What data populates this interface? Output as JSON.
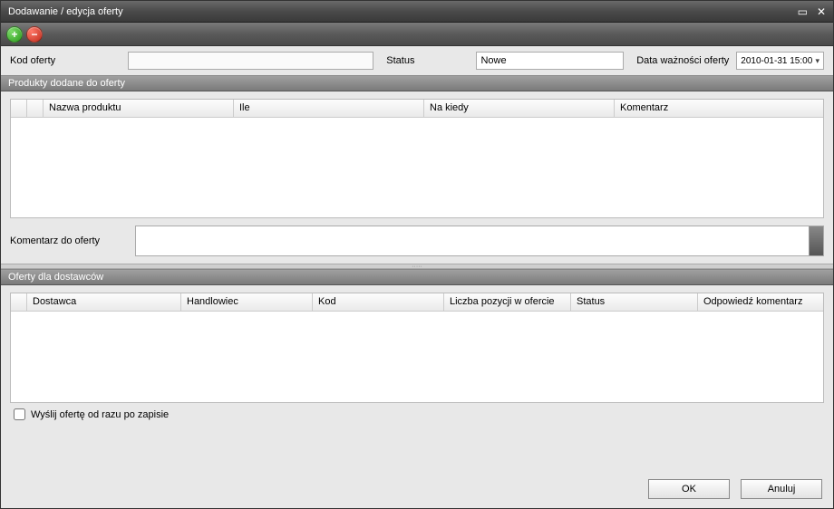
{
  "window": {
    "title": "Dodawanie / edycja oferty"
  },
  "toolbar": {
    "add_title": "Dodaj",
    "remove_title": "Usuń"
  },
  "form": {
    "kod_label": "Kod oferty",
    "kod_value": "",
    "status_label": "Status",
    "status_value": "Nowe",
    "validity_label": "Data ważności oferty",
    "validity_value": "2010-01-31 15:00"
  },
  "products_section": {
    "title": "Produkty dodane do oferty",
    "columns": {
      "name": "Nazwa produktu",
      "qty": "Ile",
      "when": "Na kiedy",
      "comment": "Komentarz"
    },
    "comment_label": "Komentarz do oferty",
    "comment_value": ""
  },
  "suppliers_section": {
    "title": "Oferty dla dostawców",
    "columns": {
      "supplier": "Dostawca",
      "salesman": "Handlowiec",
      "code": "Kod",
      "positions": "Liczba pozycji w ofercie",
      "status": "Status",
      "reply": "Odpowiedź komentarz"
    },
    "send_checkbox_label": "Wyślij ofertę od razu po zapisie"
  },
  "footer": {
    "ok": "OK",
    "cancel": "Anuluj"
  }
}
